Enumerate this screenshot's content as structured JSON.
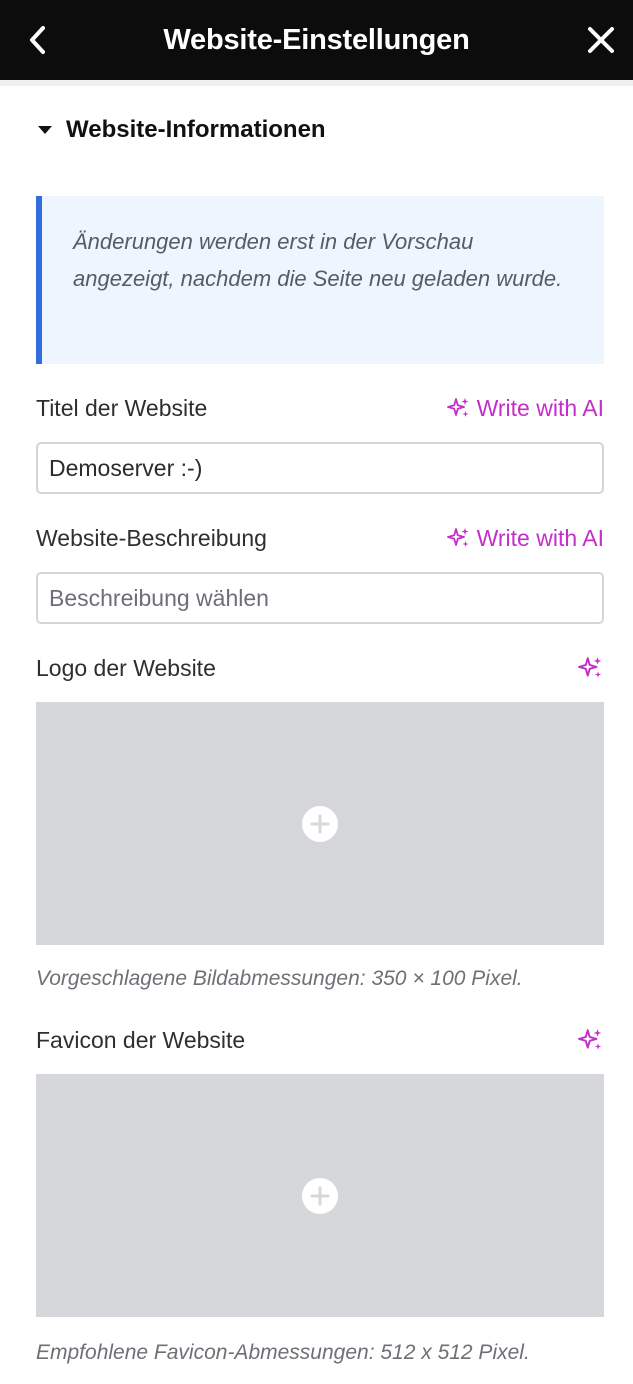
{
  "header": {
    "title": "Website-Einstellungen",
    "back_icon": "chevron-left-icon",
    "close_icon": "close-icon"
  },
  "section": {
    "title": "Website-Informationen",
    "expanded": true
  },
  "notice": {
    "text": "Änderungen werden erst in der Vorschau angezeigt, nachdem die Seite neu geladen wurde."
  },
  "fields": {
    "site_title": {
      "label": "Titel der Website",
      "ai_label": "Write with AI",
      "value": "Demoserver :-)",
      "placeholder": ""
    },
    "site_description": {
      "label": "Website-Beschreibung",
      "ai_label": "Write with AI",
      "value": "",
      "placeholder": "Beschreibung wählen"
    },
    "site_logo": {
      "label": "Logo der Website",
      "hint": "Vorgeschlagene Bildabmessungen: 350 × 100 Pixel."
    },
    "site_favicon": {
      "label": "Favicon der Website",
      "hint": "Empfohlene Favicon-Abmessungen: 512 x 512 Pixel."
    }
  },
  "colors": {
    "header_bg": "#0c0c0c",
    "accent_ai": "#c22fc9",
    "notice_border": "#2f6fdd",
    "notice_bg": "#eef5fe",
    "media_bg": "#d6d7da"
  }
}
